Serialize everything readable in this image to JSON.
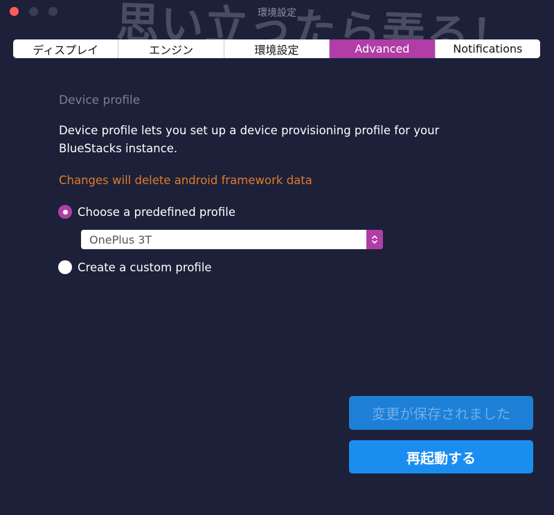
{
  "window": {
    "title": "環境設定",
    "watermark": "思い立ったら弄る！"
  },
  "tabs": [
    {
      "label": "ディスプレイ",
      "active": false
    },
    {
      "label": "エンジン",
      "active": false
    },
    {
      "label": "環境設定",
      "active": false
    },
    {
      "label": "Advanced",
      "active": true
    },
    {
      "label": "Notifications",
      "active": false
    }
  ],
  "device_profile": {
    "section_title": "Device profile",
    "description": "Device profile lets you set up a device provisioning profile for your BlueStacks instance.",
    "warning": "Changes will delete android framework data",
    "options": [
      {
        "label": "Choose a predefined profile",
        "selected": true
      },
      {
        "label": "Create a custom profile",
        "selected": false
      }
    ],
    "selected_profile": "OnePlus 3T"
  },
  "buttons": {
    "saved_label": "変更が保存されました",
    "restart_label": "再起動する"
  },
  "colors": {
    "background": "#1d2039",
    "accent": "#b13ea6",
    "warning": "#e27a2a",
    "primary_button": "#1a8df0"
  }
}
